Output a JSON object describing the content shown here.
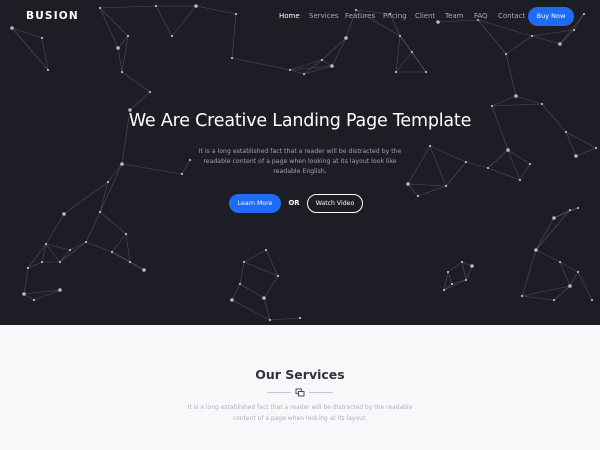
{
  "brand": "BUSION",
  "nav": {
    "links": [
      {
        "label": "Home",
        "active": true
      },
      {
        "label": "Services",
        "active": false
      },
      {
        "label": "Features",
        "active": false
      },
      {
        "label": "Pricing",
        "active": false
      },
      {
        "label": "Client",
        "active": false
      },
      {
        "label": "Team",
        "active": false
      },
      {
        "label": "FAQ",
        "active": false
      },
      {
        "label": "Contact",
        "active": false
      }
    ],
    "buy_label": "Buy Now"
  },
  "hero": {
    "title": "We Are Creative Landing Page Template",
    "description": "It is a long established fact that a reader will be distracted by the readable content of a page when looking at its layout look like readable English.",
    "learn_more_label": "Learn More",
    "or_label": "OR",
    "watch_video_label": "Watch Video",
    "background_color": "#1d1e25",
    "background_decoration": "network-lines"
  },
  "services": {
    "title": "Our Services",
    "divider_icon": "layers-icon",
    "description": "It is a long established fact that a reader will be distracted by the readable content of a page when looking at its layout."
  },
  "colors": {
    "accent": "#1e6cf6",
    "hero_bg": "#1d1e25",
    "section_bg": "#f7f8fa"
  }
}
